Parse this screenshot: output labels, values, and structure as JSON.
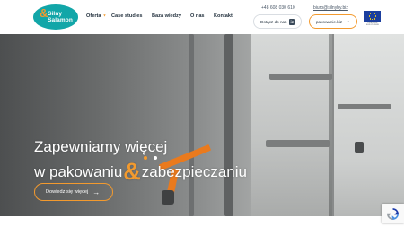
{
  "header": {
    "logo": {
      "line1": "Silny",
      "amp": "&",
      "line2": "Salamon"
    },
    "nav": [
      {
        "label": "Oferta",
        "has_dropdown": true
      },
      {
        "label": "Case studies",
        "has_dropdown": false
      },
      {
        "label": "Baza wiedzy",
        "has_dropdown": false
      },
      {
        "label": "O nas",
        "has_dropdown": false
      },
      {
        "label": "Kontakt",
        "has_dropdown": false
      }
    ],
    "phone": "+48 608 030 610",
    "email": "biuro@silnyby.biz",
    "contact_button": "Dotącz do nas",
    "pack_button": "pakowanie.biz",
    "eu_caption": "FUNDUSZE EUROPEJSKIE"
  },
  "hero": {
    "title_line1": "Zapewniamy więcej",
    "title_line2_before": "w pakowaniu",
    "title_amp": "&",
    "title_line2_after": "zabezpieczaniu",
    "cta": "Dowiedz się więcej",
    "slides_total": 2,
    "active_slide": 1
  },
  "colors": {
    "accent": "#f39a2e",
    "brand_teal": "#12a6a8",
    "text_dark": "#1f2d3a"
  },
  "icons": [
    "chevron-down-icon",
    "linkedin-icon",
    "arrow-right-icon",
    "eu-flag-icon",
    "recaptcha-icon"
  ]
}
